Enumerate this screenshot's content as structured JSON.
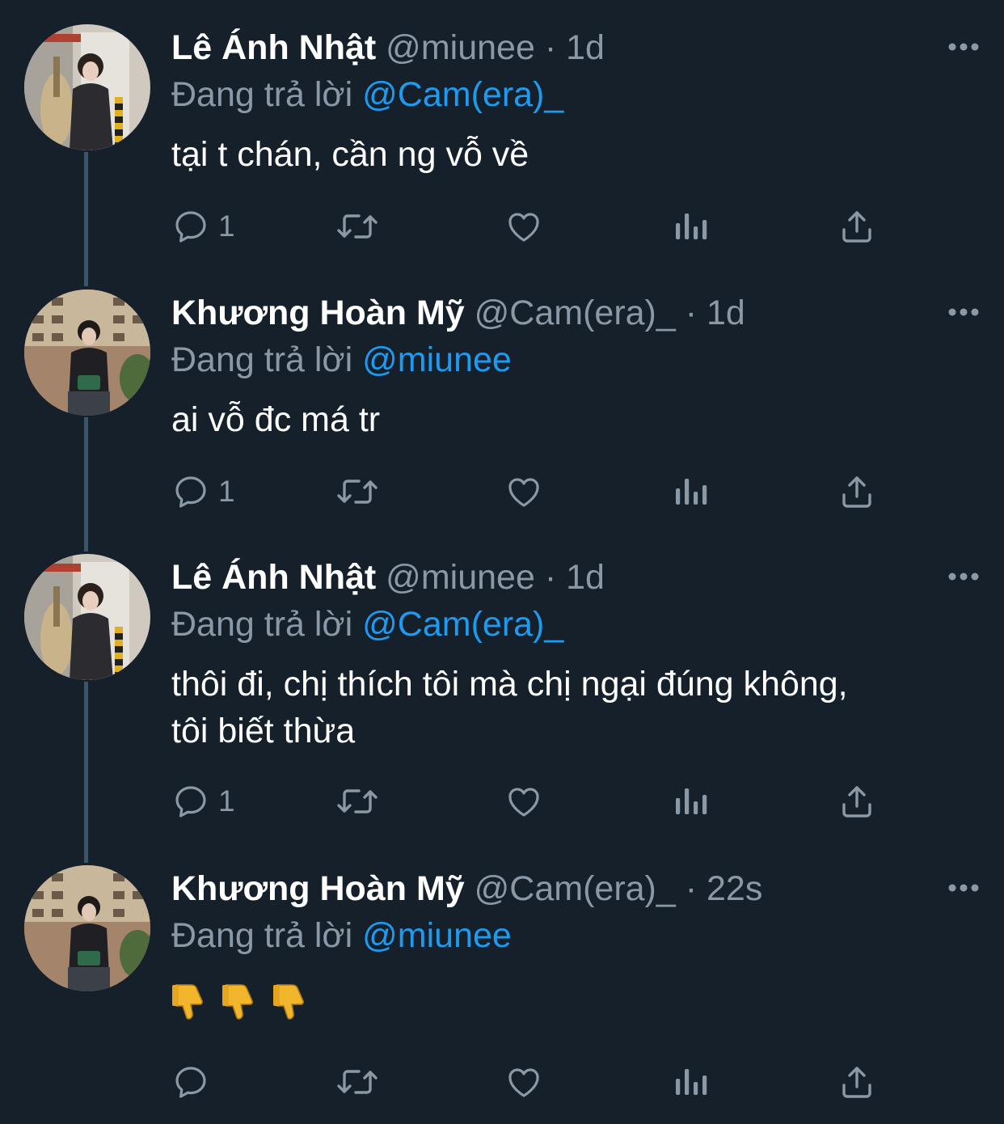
{
  "tweets": [
    {
      "name": "Lê Ánh Nhật",
      "handle": "@miunee",
      "separator": "·",
      "time": "1d",
      "reply_prefix": "Đang trả lời",
      "reply_handle": "@Cam(era)_",
      "text": "tại t chán, cần ng vỗ về",
      "reply_count": "1"
    },
    {
      "name": "Khương Hoàn Mỹ",
      "handle": "@Cam(era)_",
      "separator": "·",
      "time": "1d",
      "reply_prefix": "Đang trả lời",
      "reply_handle": "@miunee",
      "text": "ai vỗ đc má tr",
      "reply_count": "1"
    },
    {
      "name": "Lê Ánh Nhật",
      "handle": "@miunee",
      "separator": "·",
      "time": "1d",
      "reply_prefix": "Đang trả lời",
      "reply_handle": "@Cam(era)_",
      "text_lines": [
        "thôi đi, chị thích tôi mà chị ngại đúng không,",
        "tôi biết thừa"
      ],
      "reply_count": "1"
    },
    {
      "name": "Khương Hoàn Mỹ",
      "handle": "@Cam(era)_",
      "separator": "·",
      "time": "22s",
      "reply_prefix": "Đang trả lời",
      "reply_handle": "@miunee",
      "emoji": [
        "thumbs-down",
        "thumbs-down",
        "thumbs-down"
      ],
      "reply_count": ""
    }
  ],
  "colors": {
    "background": "#15202b",
    "text_primary": "#ffffff",
    "text_secondary": "#8b98a5",
    "link": "#1d9bf0",
    "thread_line": "#3d5466"
  },
  "icons": [
    "reply-icon",
    "retweet-icon",
    "like-icon",
    "views-icon",
    "share-icon",
    "more-icon"
  ]
}
